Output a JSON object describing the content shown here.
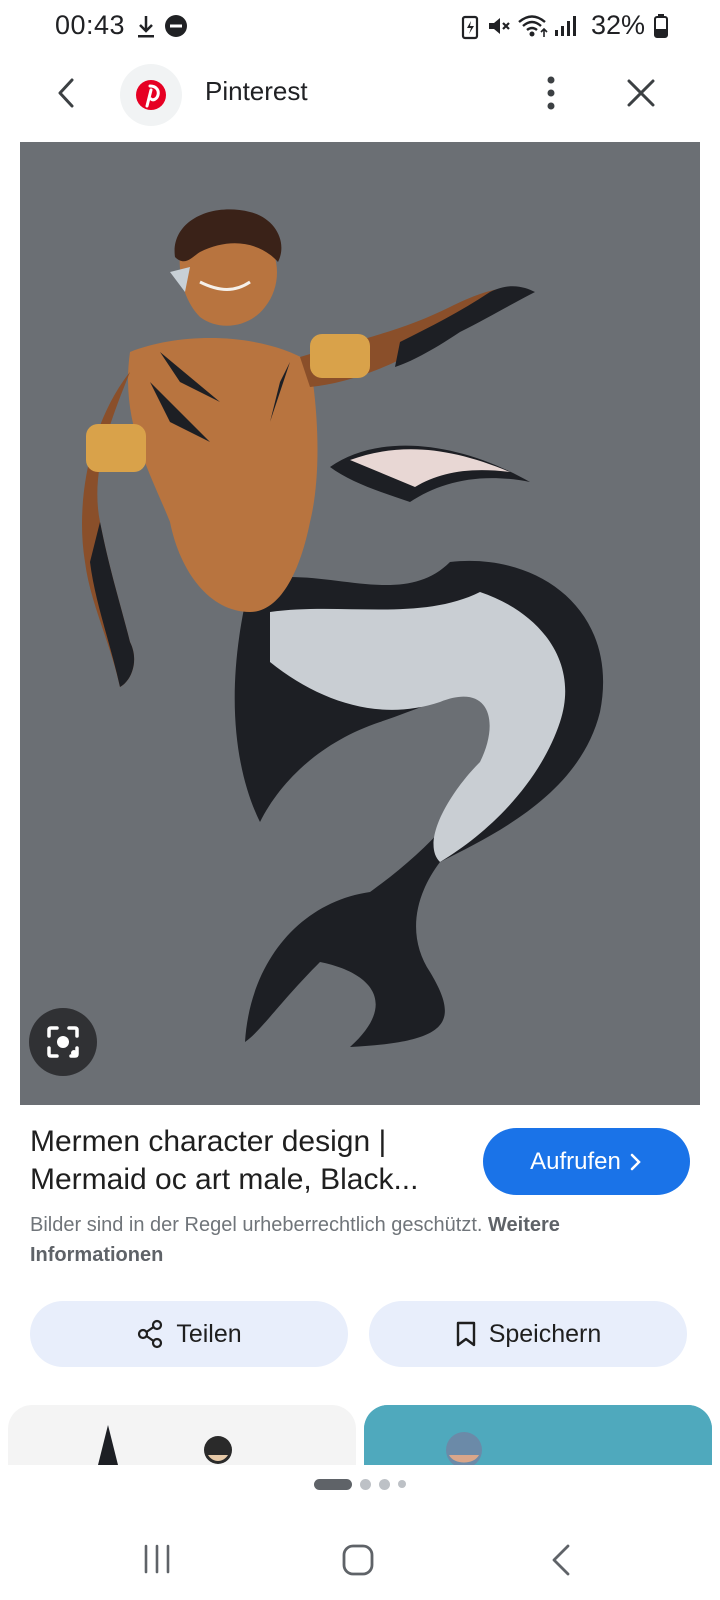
{
  "status_bar": {
    "time": "00:43",
    "battery": "32%"
  },
  "top_bar": {
    "site_name": "Pinterest"
  },
  "result": {
    "title": "Mermen character design | Mermaid oc art male, Black...",
    "visit_label": "Aufrufen",
    "copyright_text": "Bilder sind in der Regel urheberrechtlich geschützt.",
    "more_info_label": "Weitere Informationen",
    "share_label": "Teilen",
    "save_label": "Speichern"
  },
  "colors": {
    "accent": "#1a73e8",
    "image_background": "#6b6f74",
    "chip_background": "#e8eefb",
    "pinterest_red": "#e60023"
  }
}
